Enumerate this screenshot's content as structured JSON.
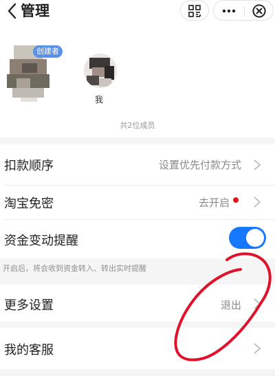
{
  "header": {
    "title": "管理"
  },
  "icons": {
    "back": "chevron-left-icon",
    "scan": "scan-icon",
    "more": "more-dots-icon",
    "close": "close-circle-icon"
  },
  "members": {
    "creator_badge": "创建者",
    "me_label": "我",
    "count": "共2位成员"
  },
  "settings": {
    "deduction_order": {
      "label": "扣款顺序",
      "value": "设置优先付款方式"
    },
    "taobao_free": {
      "label": "淘宝免密",
      "value": "去开启"
    },
    "fund_alert": {
      "label": "资金变动提醒",
      "enabled": true,
      "hint": "开启后，将会收到资金转入、转出实时提醒"
    },
    "more_settings": {
      "label": "更多设置",
      "value": "退出"
    },
    "customer_service": {
      "label": "我的客服"
    }
  },
  "colors": {
    "accent": "#1677ff",
    "badge": "#5a91e8",
    "red_dot": "#e8141b",
    "annotation": "#e0112a"
  }
}
